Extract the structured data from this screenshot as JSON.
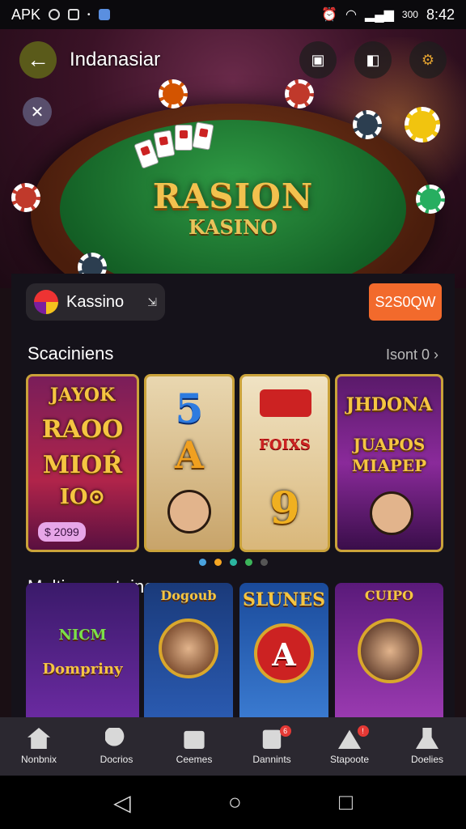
{
  "status_bar": {
    "left_text": "APK",
    "time": "8:42",
    "battery_text": "300"
  },
  "header": {
    "title": "Indanasiar"
  },
  "hero": {
    "title": "RASION",
    "subtitle": "KASINO"
  },
  "casino": {
    "name": "Kassino",
    "arrow": "⇲",
    "price_button": "S2S0QW"
  },
  "section1": {
    "title": "Scaciniens",
    "more": "Isont 0 ›",
    "slots": [
      {
        "line1": "JAYOK",
        "line2": "RAOO",
        "line3": "MIOŔ",
        "line4": "IO⊙",
        "price": "$ 2099"
      },
      {
        "line1": "5",
        "line2": "A"
      },
      {
        "line1": "FOIXS",
        "line2": "9"
      },
      {
        "line1": "JHDONA",
        "line2": "JUAPOS",
        "line3": "MIAPEP"
      }
    ]
  },
  "carousel_dots": [
    "#4aa3df",
    "#f5a623",
    "#2bb5a0",
    "#3cb45a",
    "#555555"
  ],
  "section2": {
    "title": "Maltipramatainer",
    "arrow": "›",
    "tiles": [
      {
        "line1": "NICM",
        "line2": "Dompriny"
      },
      {
        "line1": "Dogoub"
      },
      {
        "line1": "SLUNES",
        "line2": "A"
      },
      {
        "line1": "CUIPO"
      }
    ]
  },
  "bottom_nav": [
    {
      "label": "Nonbnix",
      "icon": "home-icon",
      "badge": ""
    },
    {
      "label": "Docrios",
      "icon": "search-icon",
      "badge": ""
    },
    {
      "label": "Ceemes",
      "icon": "games-icon",
      "badge": ""
    },
    {
      "label": "Dannints",
      "icon": "calendar-icon",
      "badge": "6"
    },
    {
      "label": "Stapoote",
      "icon": "promotions-icon",
      "badge": "!"
    },
    {
      "label": "Doelies",
      "icon": "profile-icon",
      "badge": ""
    }
  ],
  "colors": {
    "accent_orange": "#f26a2c",
    "gold": "#f2c14e",
    "felt_green": "#146126",
    "panel": "#15121a"
  }
}
